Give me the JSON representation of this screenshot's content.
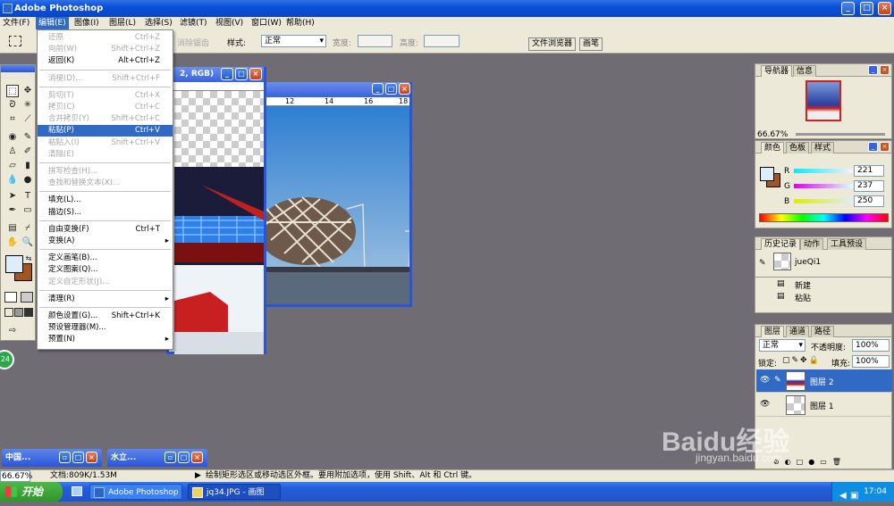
{
  "app": {
    "title": "Adobe Photoshop"
  },
  "menubar": [
    "文件(F)",
    "编辑(E)",
    "图像(I)",
    "图层(L)",
    "选择(S)",
    "滤镜(T)",
    "视图(V)",
    "窗口(W)",
    "帮助(H)"
  ],
  "options": {
    "antialias": "消除锯齿",
    "style_label": "样式:",
    "style_value": "正常",
    "width_label": "宽度:",
    "height_label": "高度:",
    "tab1": "文件浏览器",
    "tab2": "画笔"
  },
  "doc1": {
    "title_tail": "2, RGB)"
  },
  "doc2": {
    "ruler": [
      "12",
      "14",
      "16",
      "18"
    ]
  },
  "edit_menu": {
    "items": [
      {
        "label": "还原",
        "shortcut": "Ctrl+Z",
        "disabled": true
      },
      {
        "label": "向前(W)",
        "shortcut": "Shift+Ctrl+Z",
        "disabled": true
      },
      {
        "label": "返回(K)",
        "shortcut": "Alt+Ctrl+Z",
        "disabled": false
      },
      {
        "label": "消褪(D)...",
        "shortcut": "Shift+Ctrl+F",
        "disabled": true
      },
      {
        "label": "剪切(T)",
        "shortcut": "Ctrl+X",
        "disabled": true
      },
      {
        "label": "拷贝(C)",
        "shortcut": "Ctrl+C",
        "disabled": true
      },
      {
        "label": "合并拷贝(Y)",
        "shortcut": "Shift+Ctrl+C",
        "disabled": true
      },
      {
        "label": "粘贴(P)",
        "shortcut": "Ctrl+V",
        "disabled": false,
        "selected": true
      },
      {
        "label": "粘贴入(I)",
        "shortcut": "Shift+Ctrl+V",
        "disabled": true
      },
      {
        "label": "清除(E)",
        "shortcut": "",
        "disabled": true
      },
      {
        "label": "拼写检查(H)...",
        "shortcut": "",
        "disabled": true
      },
      {
        "label": "查找和替换文本(X)...",
        "shortcut": "",
        "disabled": true
      },
      {
        "label": "填充(L)...",
        "shortcut": "",
        "disabled": false
      },
      {
        "label": "描边(S)...",
        "shortcut": "",
        "disabled": false
      },
      {
        "label": "自由变换(F)",
        "shortcut": "Ctrl+T",
        "disabled": false
      },
      {
        "label": "变换(A)",
        "shortcut": "",
        "disabled": false,
        "submenu": true
      },
      {
        "label": "定义画笔(B)...",
        "shortcut": "",
        "disabled": false
      },
      {
        "label": "定义图案(Q)...",
        "shortcut": "",
        "disabled": false
      },
      {
        "label": "定义自定形状(J)...",
        "shortcut": "",
        "disabled": true
      },
      {
        "label": "清理(R)",
        "shortcut": "",
        "disabled": false,
        "submenu": true
      },
      {
        "label": "颜色设置(G)...",
        "shortcut": "Shift+Ctrl+K",
        "disabled": false
      },
      {
        "label": "预设管理器(M)...",
        "shortcut": "",
        "disabled": false
      },
      {
        "label": "预置(N)",
        "shortcut": "",
        "disabled": false,
        "submenu": true
      }
    ]
  },
  "navigator": {
    "tab1": "导航器",
    "tab2": "信息",
    "zoom": "66.67%"
  },
  "color": {
    "tab1": "颜色",
    "tab2": "色板",
    "tab3": "样式",
    "r_label": "R",
    "g_label": "G",
    "b_label": "B",
    "r": "221",
    "g": "237",
    "b": "250"
  },
  "history": {
    "tab1": "历史记录",
    "tab2": "动作",
    "tab3": "工具预设",
    "snapshot": "jueQi1",
    "steps": [
      "新建",
      "粘贴"
    ]
  },
  "layers": {
    "tab1": "图层",
    "tab2": "通道",
    "tab3": "路径",
    "mode": "正常",
    "opacity_label": "不透明度:",
    "opacity": "100%",
    "lock_label": "锁定:",
    "fill_label": "填充:",
    "fill": "100%",
    "items": [
      "图层 2",
      "图层 1"
    ]
  },
  "minimized": [
    "中国...",
    "水立..."
  ],
  "status": {
    "zoom": "66.67%",
    "doc": "文档:809K/1.53M",
    "hint": "绘制矩形选区或移动选区外框。要用附加选项，使用 Shift、Alt 和 Ctrl 键。"
  },
  "taskbar": {
    "start": "开始",
    "task1": "Adobe Photoshop",
    "task2": "jq34.JPG - 画图",
    "clock": "17:04"
  },
  "badge": "24",
  "watermark": {
    "brand": "Baidu经验",
    "url": "jingyan.baidu.com"
  },
  "colors": {
    "fg": "#ddedfa",
    "bg": "#a0561e"
  }
}
